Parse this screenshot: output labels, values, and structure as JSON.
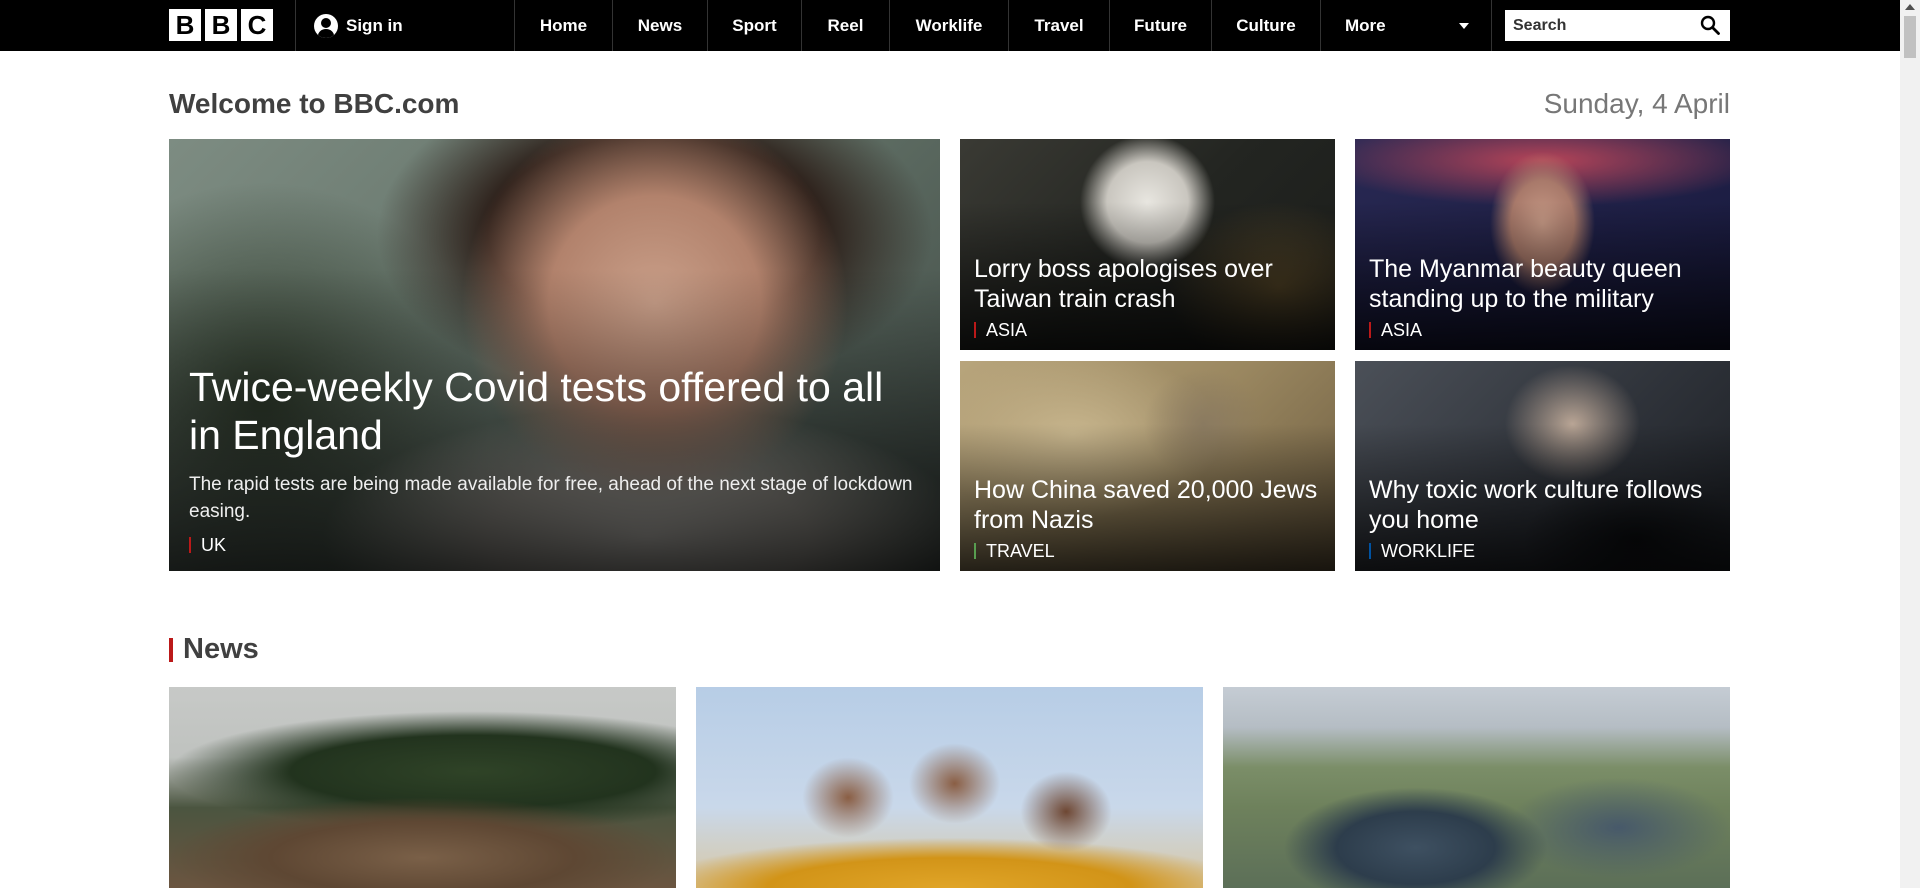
{
  "header": {
    "logo_letters": [
      "B",
      "B",
      "C"
    ],
    "sign_in_label": "Sign in",
    "nav_items": [
      {
        "label": "Home",
        "w": 97
      },
      {
        "label": "News",
        "w": 94
      },
      {
        "label": "Sport",
        "w": 93
      },
      {
        "label": "Reel",
        "w": 87
      },
      {
        "label": "Worklife",
        "w": 118
      },
      {
        "label": "Travel",
        "w": 100
      },
      {
        "label": "Future",
        "w": 101
      },
      {
        "label": "Culture",
        "w": 108
      }
    ],
    "more_label": "More",
    "search_placeholder": "Search"
  },
  "welcome": {
    "title": "Welcome to BBC.com",
    "date": "Sunday, 4 April"
  },
  "hero": {
    "headline": "Twice-weekly Covid tests offered to all in England",
    "summary": "The rapid tests are being made available for free, ahead of the next stage of lockdown easing.",
    "category": "UK",
    "category_color": "#bb1919"
  },
  "stories": [
    {
      "headline": "Lorry boss apologises over Taiwan train crash",
      "category": "ASIA",
      "category_color": "#bb1919"
    },
    {
      "headline": "The Myanmar beauty queen standing up to the military",
      "category": "ASIA",
      "category_color": "#bb1919"
    },
    {
      "headline": "How China saved 20,000 Jews from Nazis",
      "category": "TRAVEL",
      "category_color": "#589e50"
    },
    {
      "headline": "Why toxic work culture follows you home",
      "category": "WORKLIFE",
      "category_color": "#0052a1"
    }
  ],
  "news_section": {
    "title": "News"
  }
}
